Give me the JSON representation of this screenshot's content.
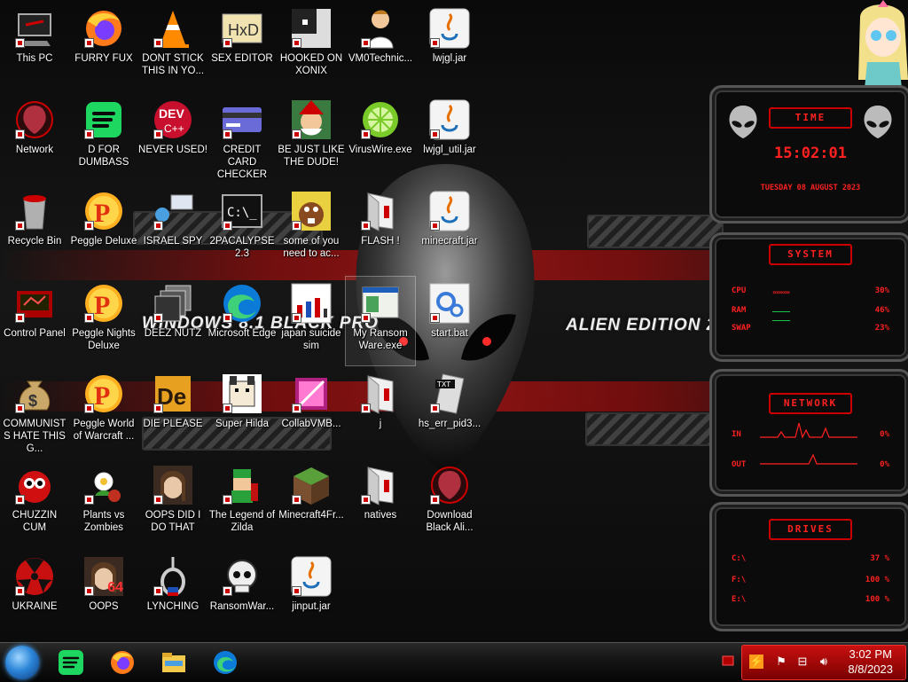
{
  "wallpaper": {
    "left_title": "WINDOWS 8.1 BLACK PRO",
    "right_title": "ALIEN EDITION 20"
  },
  "desktop_icons": [
    {
      "label": "This PC",
      "icon": "this-pc-icon"
    },
    {
      "label": "FURRY FUX",
      "icon": "firefox-icon"
    },
    {
      "label": "DONT STICK THIS IN YO...",
      "icon": "vlc-cone-icon"
    },
    {
      "label": "SEX EDITOR",
      "icon": "hxd-editor-icon"
    },
    {
      "label": "HOOKED ON XONIX",
      "icon": "xonix-game-icon"
    },
    {
      "label": "VM0Technic...",
      "icon": "doctor-icon"
    },
    {
      "label": "lwjgl.jar",
      "icon": "java-jar-icon"
    },
    {
      "label": "Network",
      "icon": "alien-network-icon"
    },
    {
      "label": "D FOR DUMBASS",
      "icon": "spotify-icon"
    },
    {
      "label": "NEVER USED!",
      "icon": "dev-cpp-icon"
    },
    {
      "label": "CREDIT CARD CHECKER",
      "icon": "credit-card-icon"
    },
    {
      "label": "BE JUST LIKE THE DUDE!",
      "icon": "santa-elf-icon"
    },
    {
      "label": "VirusWire.exe",
      "icon": "limewire-icon"
    },
    {
      "label": "lwjgl_util.jar",
      "icon": "java-jar-icon"
    },
    {
      "label": "Recycle Bin",
      "icon": "recycle-bin-icon"
    },
    {
      "label": "Peggle Deluxe",
      "icon": "peggle-icon"
    },
    {
      "label": "ISRAEL SPY",
      "icon": "spy-tool-icon"
    },
    {
      "label": "2PACALYPSE 2.3",
      "icon": "terminal-icon"
    },
    {
      "label": "some of you need to ac...",
      "icon": "beaver-icon"
    },
    {
      "label": "FLASH !",
      "icon": "folder-icon"
    },
    {
      "label": "minecraft.jar",
      "icon": "java-jar-icon"
    },
    {
      "label": "Control Panel",
      "icon": "control-panel-icon"
    },
    {
      "label": "Peggle Nights Deluxe",
      "icon": "peggle-icon"
    },
    {
      "label": "DEEZ NUTZ",
      "icon": "stack-windows-icon"
    },
    {
      "label": "Microsoft Edge",
      "icon": "edge-icon"
    },
    {
      "label": "japan suicide sim",
      "icon": "japan-sim-icon"
    },
    {
      "label": "My Ransom Ware.exe",
      "icon": "ransomware-app-icon"
    },
    {
      "label": "start.bat",
      "icon": "batch-gears-icon"
    },
    {
      "label": "COMMUNISTS HATE THIS G...",
      "icon": "money-bag-icon"
    },
    {
      "label": "Peggle World of Warcraft ...",
      "icon": "peggle-icon"
    },
    {
      "label": "DIE PLEASE",
      "icon": "director-icon"
    },
    {
      "label": "Super Hilda",
      "icon": "pixel-dog-icon"
    },
    {
      "label": "CollabVMB...",
      "icon": "collabvm-icon"
    },
    {
      "label": "j",
      "icon": "folder-icon"
    },
    {
      "label": "hs_err_pid3...",
      "icon": "text-file-icon"
    },
    {
      "label": "CHUZZIN CUM",
      "icon": "chuzzle-icon"
    },
    {
      "label": "Plants vs Zombies",
      "icon": "pvz-icon"
    },
    {
      "label": "OOPS DID I DO THAT",
      "icon": "portrait-icon"
    },
    {
      "label": "The Legend of Zilda",
      "icon": "zelda-pixel-icon"
    },
    {
      "label": "Minecraft4Fr...",
      "icon": "minecraft-block-icon"
    },
    {
      "label": "natives",
      "icon": "folder-icon"
    },
    {
      "label": "Download Black Ali...",
      "icon": "alien-download-icon"
    },
    {
      "label": "UKRAINE",
      "icon": "radiation-icon"
    },
    {
      "label": "OOPS",
      "icon": "portrait-64-icon",
      "badge": "64"
    },
    {
      "label": "LYNCHING",
      "icon": "noose-icon"
    },
    {
      "label": "RansomWar...",
      "icon": "skull-icon"
    },
    {
      "label": "jinput.jar",
      "icon": "java-jar-icon"
    }
  ],
  "widgets": {
    "time": {
      "title": "TIME",
      "clock": "15:02:01",
      "date": "TUESDAY 08 AUGUST 2023"
    },
    "system": {
      "title": "SYSTEM",
      "rows": [
        {
          "label": "CPU",
          "value": "30%",
          "bars": "»»»»»"
        },
        {
          "label": "RAM",
          "value": "46%",
          "bars": ""
        },
        {
          "label": "SWAP",
          "value": "23%",
          "bars": ""
        }
      ]
    },
    "network": {
      "title": "NETWORK",
      "rows": [
        {
          "label": "IN",
          "value": "0%"
        },
        {
          "label": "OUT",
          "value": "0%"
        }
      ]
    },
    "drives": {
      "title": "DRIVES",
      "rows": [
        {
          "label": "C:\\",
          "value": "37 %"
        },
        {
          "label": "F:\\",
          "value": "100 %"
        },
        {
          "label": "E:\\",
          "value": "100 %"
        }
      ]
    }
  },
  "taskbar": {
    "pinned": [
      {
        "name": "spotify-icon"
      },
      {
        "name": "firefox-icon"
      },
      {
        "name": "file-explorer-icon"
      },
      {
        "name": "edge-icon"
      }
    ],
    "clock_time": "3:02 PM",
    "clock_date": "8/8/2023"
  }
}
